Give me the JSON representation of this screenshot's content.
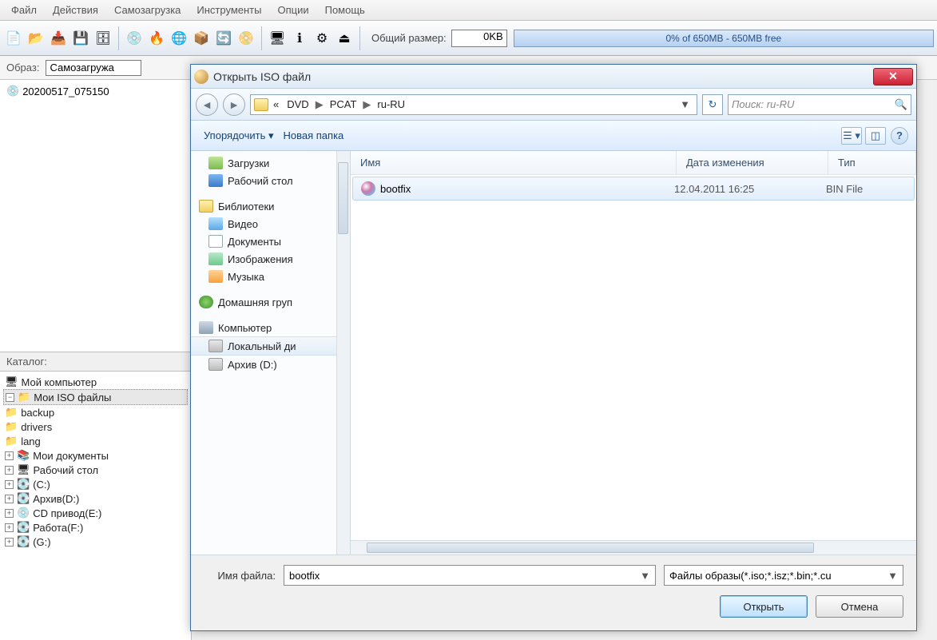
{
  "menu": {
    "file": "Файл",
    "actions": "Действия",
    "boot": "Самозагрузка",
    "tools": "Инструменты",
    "options": "Опции",
    "help": "Помощь"
  },
  "toolbar": {
    "total_label": "Общий размер:",
    "total_value": "0KB",
    "space": "0% of 650MB - 650MB free"
  },
  "imgrow": {
    "label": "Образ:",
    "value": "Самозагружа"
  },
  "topTree": {
    "node1": "20200517_075150"
  },
  "catalog": {
    "label": "Каталог:",
    "mycomp": "Мой компьютер",
    "myiso": "Мои ISO файлы",
    "backup": "backup",
    "drivers": "drivers",
    "lang": "lang",
    "mydocs": "Мои документы",
    "desktop": "Рабочий стол",
    "c": "(C:)",
    "arh": "Архив(D:)",
    "cd": "CD привод(E:)",
    "work": "Работа(F:)",
    "g": "(G:)"
  },
  "dialog": {
    "title": "Открыть ISO файл",
    "crumbs": {
      "pre": "«",
      "a": "DVD",
      "b": "PCAT",
      "c": "ru-RU"
    },
    "search_ph": "Поиск: ru-RU",
    "cmd": {
      "org": "Упорядочить",
      "newf": "Новая папка"
    },
    "places": {
      "downloads": "Загрузки",
      "desktop": "Рабочий стол",
      "libs": "Библиотеки",
      "video": "Видео",
      "docs": "Документы",
      "images": "Изображения",
      "music": "Музыка",
      "home": "Домашняя груп",
      "computer": "Компьютер",
      "local": "Локальный ди",
      "arh": "Архив (D:)"
    },
    "cols": {
      "name": "Имя",
      "date": "Дата изменения",
      "type": "Тип"
    },
    "file": {
      "name": "bootfix",
      "date": "12.04.2011 16:25",
      "type": "BIN File"
    },
    "fn_label": "Имя файла:",
    "fn_value": "bootfix",
    "filter": "Файлы образы(*.iso;*.isz;*.bin;*.cu",
    "open": "Открыть",
    "cancel": "Отмена"
  }
}
